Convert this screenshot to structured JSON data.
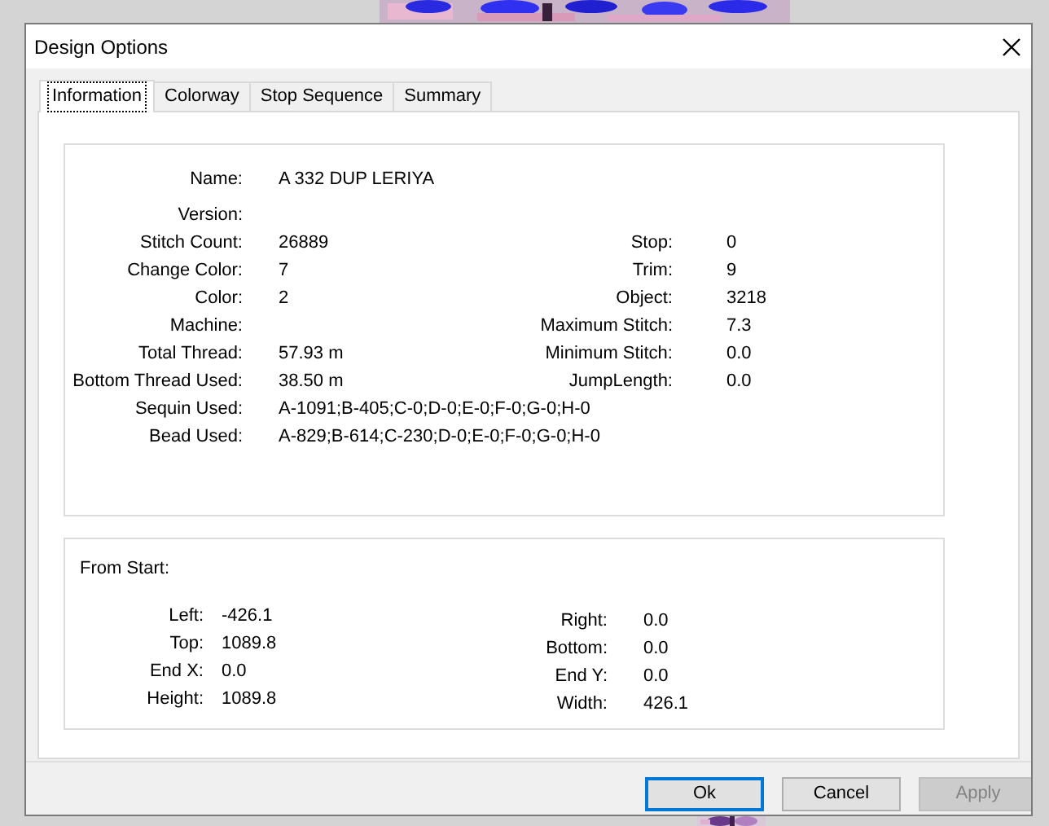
{
  "window": {
    "title": "Design Options"
  },
  "tabs": [
    {
      "label": "Information",
      "selected": true
    },
    {
      "label": "Colorway",
      "selected": false
    },
    {
      "label": "Stop Sequence",
      "selected": false
    },
    {
      "label": "Summary",
      "selected": false
    }
  ],
  "information": {
    "rows": [
      {
        "label": "Name:",
        "value": "A 332 DUP LERIYA"
      },
      {
        "label": "Version:"
      },
      {
        "label": "Stitch Count:",
        "value": "26889",
        "right_label": "Stop:",
        "right_value": "0"
      },
      {
        "label": "Change Color:",
        "value": "7",
        "right_label": "Trim:",
        "right_value": "9"
      },
      {
        "label": "Color:",
        "value": "2",
        "right_label": "Object:",
        "right_value": "3218"
      },
      {
        "label": "Machine:",
        "right_label": "Maximum Stitch:",
        "right_value": "7.3"
      },
      {
        "label": "Total Thread:",
        "value": "57.93 m",
        "right_label": "Minimum Stitch:",
        "right_value": "0.0"
      },
      {
        "label": "Bottom Thread Used:",
        "value": "38.50 m",
        "right_label": "JumpLength:",
        "right_value": "0.0"
      },
      {
        "label": "Sequin Used:",
        "value": "A-1091;B-405;C-0;D-0;E-0;F-0;G-0;H-0"
      },
      {
        "label": "Bead Used:",
        "value": "A-829;B-614;C-230;D-0;E-0;F-0;G-0;H-0"
      }
    ]
  },
  "from_start": {
    "title": "From Start:",
    "left_items": [
      {
        "label": "Left:",
        "value": "-426.1"
      },
      {
        "label": "Top:",
        "value": "1089.8"
      },
      {
        "label": "End X:",
        "value": "0.0"
      },
      {
        "label": "Height:",
        "value": "1089.8"
      }
    ],
    "right_items": [
      {
        "label": "Right:",
        "value": "0.0"
      },
      {
        "label": "Bottom:",
        "value": "0.0"
      },
      {
        "label": "End Y:",
        "value": "0.0"
      },
      {
        "label": "Width:",
        "value": "426.1"
      }
    ]
  },
  "buttons": [
    {
      "label": "Ok",
      "default": true,
      "disabled": false
    },
    {
      "label": "Cancel",
      "default": false,
      "disabled": false
    },
    {
      "label": "Apply",
      "default": false,
      "disabled": true
    }
  ]
}
